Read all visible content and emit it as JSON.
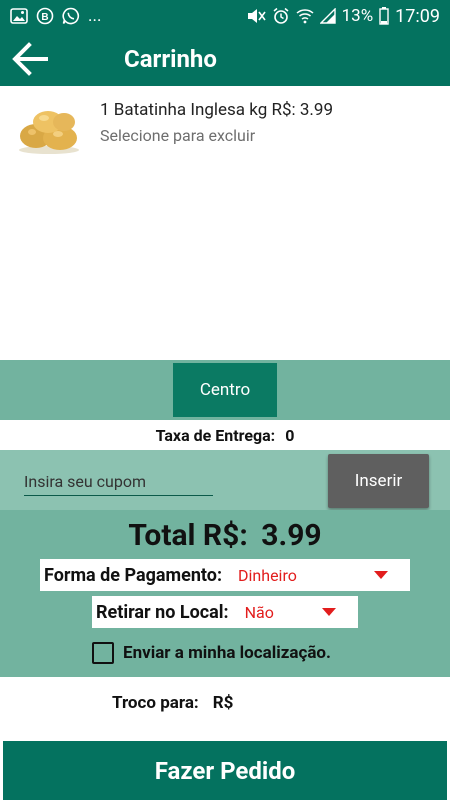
{
  "status_bar": {
    "battery": "13%",
    "time": "17:09",
    "more": "...",
    "icons": [
      "photo-icon",
      "b-badge-icon",
      "whatsapp-icon",
      "mute-icon",
      "alarm-icon",
      "wifi-icon",
      "signal-icon",
      "battery-icon"
    ]
  },
  "toolbar": {
    "title": "Carrinho",
    "back_icon": "arrow-left-icon"
  },
  "cart": {
    "items": [
      {
        "text": "1 Batatinha Inglesa kg R$: 3.99",
        "hint": "Selecione para excluir",
        "image": "potatoes"
      }
    ]
  },
  "region": {
    "button_label": "Centro"
  },
  "delivery": {
    "label": "Taxa de Entrega:",
    "value": "0"
  },
  "coupon": {
    "placeholder": "Insira seu cupom",
    "button_label": "Inserir"
  },
  "total": {
    "label": "Total R$:",
    "value": "3.99"
  },
  "payment": {
    "label": "Forma de Pagamento:",
    "value": "Dinheiro"
  },
  "pickup": {
    "label": "Retirar no Local:",
    "value": "Não"
  },
  "location": {
    "label": "Enviar a minha localização.",
    "checked": false
  },
  "change": {
    "label": "Troco para:",
    "currency": "R$"
  },
  "submit": {
    "label": "Fazer Pedido"
  },
  "colors": {
    "primary": "#04725f",
    "band": "#72b39f",
    "accent_red": "#e21d1d",
    "button_gray": "#5f5f5f"
  }
}
